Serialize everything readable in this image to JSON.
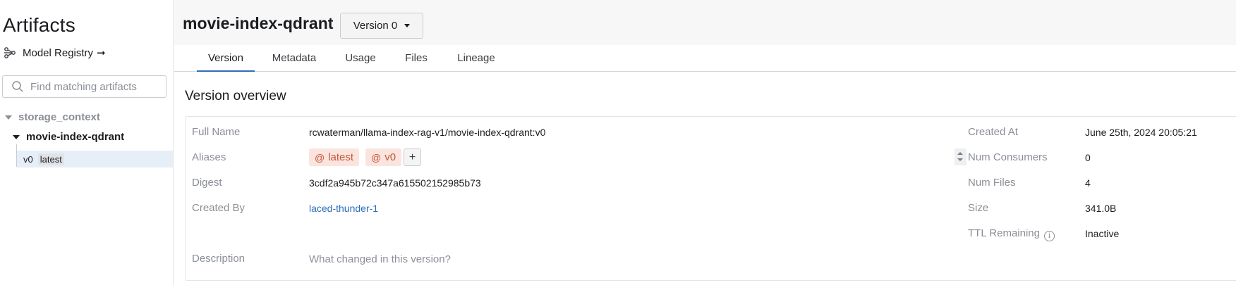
{
  "sidebar": {
    "title": "Artifacts",
    "registry_label": "Model Registry",
    "registry_arrow": "➞",
    "search_placeholder": "Find matching artifacts",
    "group": "storage_context",
    "item": "movie-index-qdrant",
    "version": "v0",
    "version_tag": "latest"
  },
  "header": {
    "title": "movie-index-qdrant",
    "version_dropdown": "Version 0"
  },
  "tabs": [
    "Version",
    "Metadata",
    "Usage",
    "Files",
    "Lineage"
  ],
  "active_tab": "Version",
  "overview": {
    "heading": "Version overview",
    "labels": {
      "full_name": "Full Name",
      "aliases": "Aliases",
      "digest": "Digest",
      "created_by": "Created By",
      "description": "Description",
      "created_at": "Created At",
      "num_consumers": "Num Consumers",
      "num_files": "Num Files",
      "size": "Size",
      "ttl_remaining": "TTL Remaining"
    },
    "values": {
      "full_name": "rcwaterman/llama-index-rag-v1/movie-index-qdrant:v0",
      "aliases": [
        "latest",
        "v0"
      ],
      "add_alias": "+",
      "digest": "3cdf2a945b72c347a615502152985b73",
      "created_by": "laced-thunder-1",
      "description_placeholder": "What changed in this version?",
      "created_at": "June 25th, 2024 20:05:21",
      "num_consumers": "0",
      "num_files": "4",
      "size": "341.0B",
      "ttl_remaining": "Inactive"
    }
  },
  "colors": {
    "accent": "#2e6dbb",
    "alias_bg": "#fbe4dd",
    "alias_text": "#c05a3e",
    "selected_row": "#e6eef7"
  }
}
